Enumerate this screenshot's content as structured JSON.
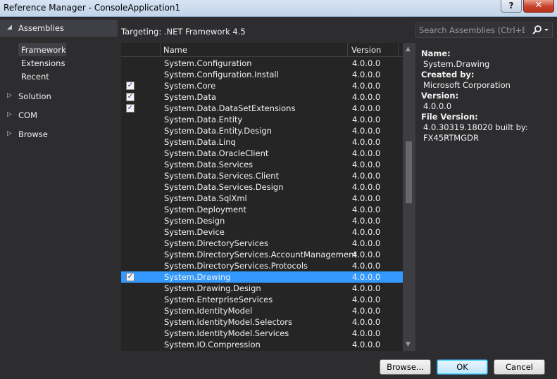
{
  "window": {
    "title": "Reference Manager - ConsoleApplication1",
    "help_label": "?",
    "close_label": "✕"
  },
  "left": {
    "assemblies": {
      "label": "Assemblies",
      "arrow": "◢"
    },
    "subitems": [
      {
        "label": "Framework"
      },
      {
        "label": "Extensions"
      },
      {
        "label": "Recent"
      }
    ],
    "nodes": [
      {
        "label": "Solution",
        "arrow": "▷"
      },
      {
        "label": "COM",
        "arrow": "▷"
      },
      {
        "label": "Browse",
        "arrow": "▷"
      }
    ]
  },
  "targeting": "Targeting: .NET Framework 4.5",
  "search": {
    "placeholder": "Search Assemblies (Ctrl+E)",
    "icon": "search-icon"
  },
  "columns": {
    "name": "Name",
    "version": "Version"
  },
  "rows": [
    {
      "name": "System.Configuration",
      "version": "4.0.0.0",
      "checked": false
    },
    {
      "name": "System.Configuration.Install",
      "version": "4.0.0.0",
      "checked": false
    },
    {
      "name": "System.Core",
      "version": "4.0.0.0",
      "checked": true
    },
    {
      "name": "System.Data",
      "version": "4.0.0.0",
      "checked": true
    },
    {
      "name": "System.Data.DataSetExtensions",
      "version": "4.0.0.0",
      "checked": true
    },
    {
      "name": "System.Data.Entity",
      "version": "4.0.0.0",
      "checked": false
    },
    {
      "name": "System.Data.Entity.Design",
      "version": "4.0.0.0",
      "checked": false
    },
    {
      "name": "System.Data.Linq",
      "version": "4.0.0.0",
      "checked": false
    },
    {
      "name": "System.Data.OracleClient",
      "version": "4.0.0.0",
      "checked": false
    },
    {
      "name": "System.Data.Services",
      "version": "4.0.0.0",
      "checked": false
    },
    {
      "name": "System.Data.Services.Client",
      "version": "4.0.0.0",
      "checked": false
    },
    {
      "name": "System.Data.Services.Design",
      "version": "4.0.0.0",
      "checked": false
    },
    {
      "name": "System.Data.SqlXml",
      "version": "4.0.0.0",
      "checked": false
    },
    {
      "name": "System.Deployment",
      "version": "4.0.0.0",
      "checked": false
    },
    {
      "name": "System.Design",
      "version": "4.0.0.0",
      "checked": false
    },
    {
      "name": "System.Device",
      "version": "4.0.0.0",
      "checked": false
    },
    {
      "name": "System.DirectoryServices",
      "version": "4.0.0.0",
      "checked": false
    },
    {
      "name": "System.DirectoryServices.AccountManagement",
      "version": "4.0.0.0",
      "checked": false
    },
    {
      "name": "System.DirectoryServices.Protocols",
      "version": "4.0.0.0",
      "checked": false
    },
    {
      "name": "System.Drawing",
      "version": "4.0.0.0",
      "checked": true,
      "selected": true
    },
    {
      "name": "System.Drawing.Design",
      "version": "4.0.0.0",
      "checked": false
    },
    {
      "name": "System.EnterpriseServices",
      "version": "4.0.0.0",
      "checked": false
    },
    {
      "name": "System.IdentityModel",
      "version": "4.0.0.0",
      "checked": false
    },
    {
      "name": "System.IdentityModel.Selectors",
      "version": "4.0.0.0",
      "checked": false
    },
    {
      "name": "System.IdentityModel.Services",
      "version": "4.0.0.0",
      "checked": false
    },
    {
      "name": "System.IO.Compression",
      "version": "4.0.0.0",
      "checked": false
    }
  ],
  "details": [
    {
      "key": "Name:",
      "value": "System.Drawing"
    },
    {
      "key": "Created by:",
      "value": "Microsoft Corporation"
    },
    {
      "key": "Version:",
      "value": "4.0.0.0"
    },
    {
      "key": "File Version:",
      "value": "4.0.30319.18020 built by: FX45RTMGDR"
    }
  ],
  "buttons": {
    "browse": "Browse...",
    "ok": "OK",
    "cancel": "Cancel"
  }
}
